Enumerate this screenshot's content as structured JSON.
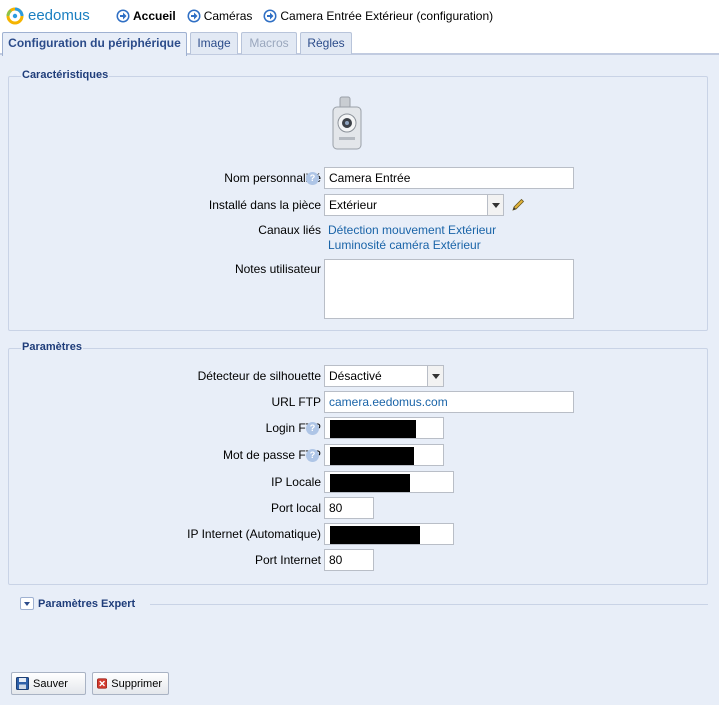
{
  "header": {
    "brand": "eedomus",
    "breadcrumb": [
      {
        "label": "Accueil",
        "bold": true
      },
      {
        "label": "Caméras",
        "bold": false
      },
      {
        "label": "Camera Entrée Extérieur (configuration)",
        "bold": false
      }
    ]
  },
  "tabs": [
    {
      "label": "Configuration du périphérique",
      "state": "active"
    },
    {
      "label": "Image",
      "state": "normal"
    },
    {
      "label": "Macros",
      "state": "disabled"
    },
    {
      "label": "Règles",
      "state": "normal"
    }
  ],
  "caracteristiques": {
    "legend": "Caractéristiques",
    "device_icon": "camera-icon",
    "nom_label": "Nom personnalisé",
    "nom_value": "Camera Entrée",
    "piece_label": "Installé dans la pièce",
    "piece_value": "Extérieur",
    "canaux_label": "Canaux liés",
    "canaux": [
      "Détection mouvement Extérieur",
      "Luminosité caméra Extérieur"
    ],
    "notes_label": "Notes utilisateur",
    "notes_value": ""
  },
  "parametres": {
    "legend": "Paramètres",
    "silhouette_label": "Détecteur de silhouette",
    "silhouette_value": "Désactivé",
    "url_ftp_label": "URL FTP",
    "url_ftp_value": "camera.eedomus.com",
    "login_ftp_label": "Login FTP",
    "mdp_ftp_label": "Mot de passe FTP",
    "ip_locale_label": "IP Locale",
    "port_local_label": "Port local",
    "port_local_value": "80",
    "ip_internet_label": "IP Internet (Automatique)",
    "port_internet_label": "Port Internet",
    "port_internet_value": "80"
  },
  "expert": {
    "label": "Paramètres Expert"
  },
  "buttons": {
    "save": "Sauver",
    "delete": "Supprimer"
  },
  "colors": {
    "accent": "#1f3d7a",
    "link": "#1a64a8",
    "background": "#e8eef8"
  }
}
